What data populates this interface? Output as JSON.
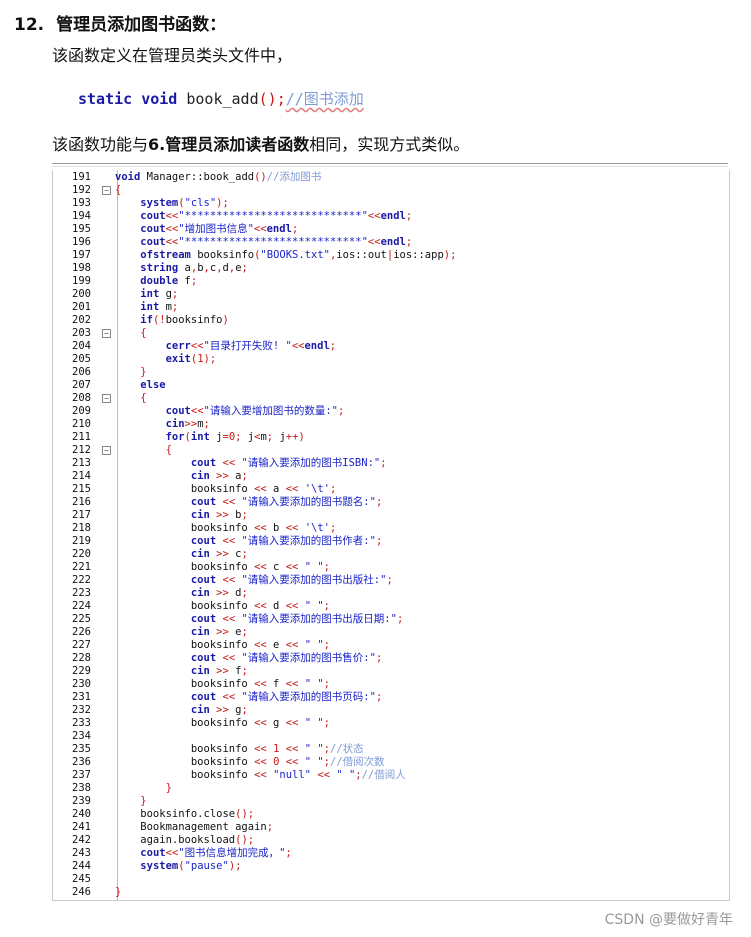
{
  "heading": {
    "number": "12.",
    "title": "管理员添加图书函数："
  },
  "intro": "该函数定义在管理员类头文件中，",
  "snippet": {
    "kw1": "static",
    "kw2": "void",
    "fn": "book_add",
    "parens": "()",
    "semi": ";",
    "comment": "//图书添加"
  },
  "desc": {
    "pre": "该函数功能与",
    "bold": "6.管理员添加读者函数",
    "post": "相同，实现方式类似。"
  },
  "code_lines": [
    {
      "n": "191",
      "fold": "",
      "t": "void Manager::book_add()//添加图书"
    },
    {
      "n": "192",
      "fold": "⊟",
      "t": "{"
    },
    {
      "n": "193",
      "fold": "",
      "t": "    system(\"cls\");"
    },
    {
      "n": "194",
      "fold": "",
      "t": "    cout<<\"****************************\"<<endl;"
    },
    {
      "n": "195",
      "fold": "",
      "t": "    cout<<\"增加图书信息\"<<endl;"
    },
    {
      "n": "196",
      "fold": "",
      "t": "    cout<<\"****************************\"<<endl;"
    },
    {
      "n": "197",
      "fold": "",
      "t": "    ofstream booksinfo(\"BOOKS.txt\",ios::out|ios::app);"
    },
    {
      "n": "198",
      "fold": "",
      "t": "    string a,b,c,d,e;"
    },
    {
      "n": "199",
      "fold": "",
      "t": "    double f;"
    },
    {
      "n": "200",
      "fold": "",
      "t": "    int g;"
    },
    {
      "n": "201",
      "fold": "",
      "t": "    int m;"
    },
    {
      "n": "202",
      "fold": "",
      "t": "    if(!booksinfo)"
    },
    {
      "n": "203",
      "fold": "⊟",
      "t": "    {"
    },
    {
      "n": "204",
      "fold": "",
      "t": "        cerr<<\"目录打开失败! \"<<endl;"
    },
    {
      "n": "205",
      "fold": "",
      "t": "        exit(1);"
    },
    {
      "n": "206",
      "fold": "",
      "t": "    }"
    },
    {
      "n": "207",
      "fold": "",
      "t": "    else"
    },
    {
      "n": "208",
      "fold": "⊟",
      "t": "    {"
    },
    {
      "n": "209",
      "fold": "",
      "t": "        cout<<\"请输入要增加图书的数量:\";"
    },
    {
      "n": "210",
      "fold": "",
      "t": "        cin>>m;"
    },
    {
      "n": "211",
      "fold": "",
      "t": "        for(int j=0; j<m; j++)"
    },
    {
      "n": "212",
      "fold": "⊟",
      "t": "        {"
    },
    {
      "n": "213",
      "fold": "",
      "t": "            cout << \"请输入要添加的图书ISBN:\";"
    },
    {
      "n": "214",
      "fold": "",
      "t": "            cin >> a;"
    },
    {
      "n": "215",
      "fold": "",
      "t": "            booksinfo << a << '\\t';"
    },
    {
      "n": "216",
      "fold": "",
      "t": "            cout << \"请输入要添加的图书题名:\";"
    },
    {
      "n": "217",
      "fold": "",
      "t": "            cin >> b;"
    },
    {
      "n": "218",
      "fold": "",
      "t": "            booksinfo << b << '\\t';"
    },
    {
      "n": "219",
      "fold": "",
      "t": "            cout << \"请输入要添加的图书作者:\";"
    },
    {
      "n": "220",
      "fold": "",
      "t": "            cin >> c;"
    },
    {
      "n": "221",
      "fold": "",
      "t": "            booksinfo << c << \" \";"
    },
    {
      "n": "222",
      "fold": "",
      "t": "            cout << \"请输入要添加的图书出版社:\";"
    },
    {
      "n": "223",
      "fold": "",
      "t": "            cin >> d;"
    },
    {
      "n": "224",
      "fold": "",
      "t": "            booksinfo << d << \" \";"
    },
    {
      "n": "225",
      "fold": "",
      "t": "            cout << \"请输入要添加的图书出版日期:\";"
    },
    {
      "n": "226",
      "fold": "",
      "t": "            cin >> e;"
    },
    {
      "n": "227",
      "fold": "",
      "t": "            booksinfo << e << \" \";"
    },
    {
      "n": "228",
      "fold": "",
      "t": "            cout << \"请输入要添加的图书售价:\";"
    },
    {
      "n": "229",
      "fold": "",
      "t": "            cin >> f;"
    },
    {
      "n": "230",
      "fold": "",
      "t": "            booksinfo << f << \" \";"
    },
    {
      "n": "231",
      "fold": "",
      "t": "            cout << \"请输入要添加的图书页码:\";"
    },
    {
      "n": "232",
      "fold": "",
      "t": "            cin >> g;"
    },
    {
      "n": "233",
      "fold": "",
      "t": "            booksinfo << g << \" \";"
    },
    {
      "n": "234",
      "fold": "",
      "t": ""
    },
    {
      "n": "235",
      "fold": "",
      "t": "            booksinfo << 1 << \" \";//状态"
    },
    {
      "n": "236",
      "fold": "",
      "t": "            booksinfo << 0 << \" \";//借阅次数"
    },
    {
      "n": "237",
      "fold": "",
      "t": "            booksinfo << \"null\" << \" \";//借阅人"
    },
    {
      "n": "238",
      "fold": "",
      "t": "        }"
    },
    {
      "n": "239",
      "fold": "",
      "t": "    }"
    },
    {
      "n": "240",
      "fold": "",
      "t": "    booksinfo.close();"
    },
    {
      "n": "241",
      "fold": "",
      "t": "    Bookmanagement again;"
    },
    {
      "n": "242",
      "fold": "",
      "t": "    again.booksload();"
    },
    {
      "n": "243",
      "fold": "",
      "t": "    cout<<\"图书信息增加完成，\";"
    },
    {
      "n": "244",
      "fold": "",
      "t": "    system(\"pause\");"
    },
    {
      "n": "245",
      "fold": "",
      "t": ""
    },
    {
      "n": "246",
      "fold": "",
      "t": "}"
    }
  ],
  "watermark": "CSDN @要做好青年"
}
